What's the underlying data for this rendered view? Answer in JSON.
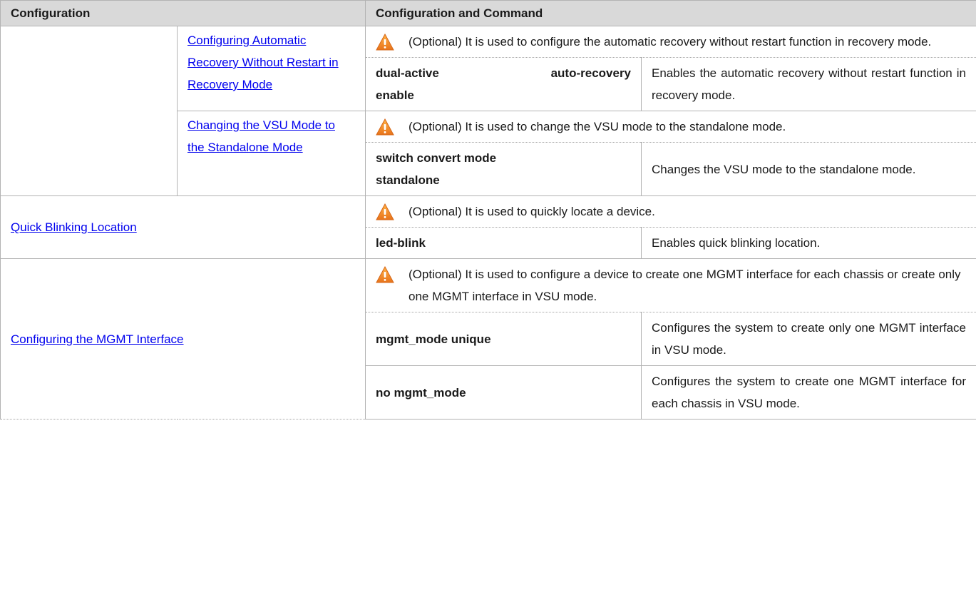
{
  "header": {
    "col1": "Configuration",
    "col2": "Configuration and Command"
  },
  "rows": {
    "auto_recovery": {
      "link": "Configuring Automatic Recovery Without Restart in Recovery Mode",
      "note": "(Optional) It is used to configure the automatic recovery without restart function in recovery mode.",
      "command_part1": "dual-active",
      "command_part2": "auto-recovery",
      "command_part3": "enable",
      "description": "Enables the automatic recovery without restart function in recovery mode."
    },
    "standalone": {
      "link": "Changing the VSU Mode to the Standalone Mode",
      "note": "(Optional) It is used to change the VSU mode to the standalone mode.",
      "command": "switch convert mode standalone",
      "description": "Changes the VSU mode to the standalone mode."
    },
    "quick_blink": {
      "link": "Quick Blinking Location",
      "note": "(Optional) It is used to quickly locate a device.",
      "command": "led-blink",
      "description": "Enables quick blinking location."
    },
    "mgmt": {
      "link": "Configuring the MGMT Interface",
      "note": "(Optional) It is used to configure a device to create one MGMT interface for each chassis or create only one MGMT interface in VSU mode.",
      "command1": "mgmt_mode unique",
      "description1": "Configures the system to create only one MGMT interface in VSU mode.",
      "command2": "no mgmt_mode",
      "description2": "Configures the system to create one MGMT interface for each chassis in VSU mode."
    }
  },
  "icons": {
    "warning": "warning-icon",
    "warning_color": "#f07f1e"
  }
}
